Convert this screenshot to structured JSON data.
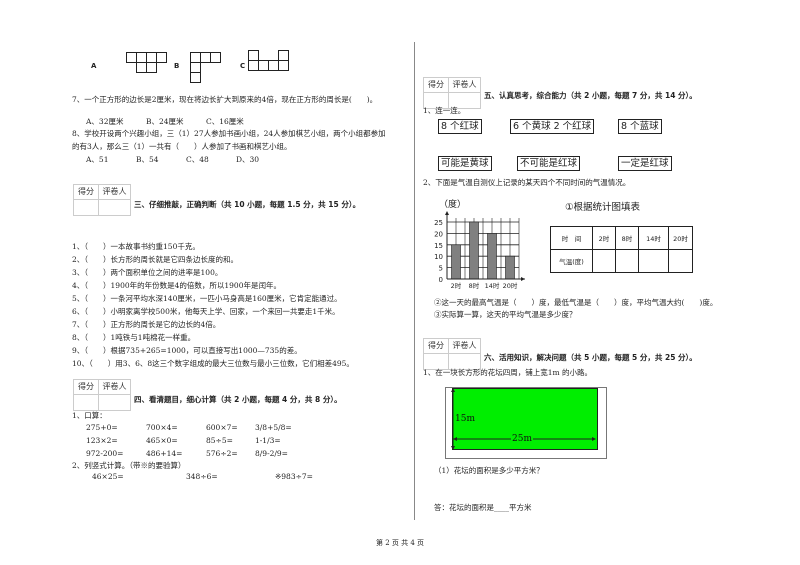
{
  "left": {
    "shapes": {
      "labels": [
        "A",
        "B",
        "C"
      ]
    },
    "q7": {
      "text": "7、一个正方形的边长是2厘米，现在将边长扩大到原来的4倍，现在正方形的周长是(　　)。",
      "options": [
        "A、32厘米",
        "B、24厘米",
        "C、16厘米"
      ]
    },
    "q8": {
      "line1": "8、学校开设两个兴趣小组，三（1）27人参加书画小组，24人参加棋艺小组，两个小组都参加",
      "line2": "的有3人，那么三（1）一共有（　　）人参加了书画和棋艺小组。",
      "options": [
        "A、51",
        "B、54",
        "C、48",
        "D、30"
      ]
    },
    "section3": {
      "score_label": "得分",
      "grader_label": "评卷人",
      "title": "三、仔细推敲，正确判断（共 10 小题，每题 1.5 分，共 15 分）。",
      "items": [
        "1、（　　）一本故事书约重150千克。",
        "2、（　　）长方形的周长就是它四条边长度的和。",
        "3、（　　）两个面积单位之间的进率是100。",
        "4、（　　）1900年的年份数是4的倍数，所以1900年是闰年。",
        "5、（　　）一条河平均水深140厘米，一匹小马身高是160厘米，它肯定能通过。",
        "6、（　　）小明家离学校500米，他每天上学、回家，一个来回一共要走1千米。",
        "7、（　　）正方形的周长是它的边长的4倍。",
        "8、（　　）1吨铁与1吨棉花一样重。",
        "9、（　　）根据735+265=1000，可以直接写出1000—735的差。",
        "10、（　　）用3、6、8这三个数字组成的最大三位数与最小三位数，它们相差495。"
      ]
    },
    "section4": {
      "score_label": "得分",
      "grader_label": "评卷人",
      "title": "四、看清题目，细心计算（共 2 小题，每题 4 分，共 8 分）。",
      "q1_label": "1、口算：",
      "oral": [
        [
          "275+0=",
          "700×4=",
          "600×7=",
          "3/8+5/8="
        ],
        [
          "123×2=",
          "465×0=",
          "85÷5=",
          "1-1/3="
        ],
        [
          "972-200=",
          "486+14=",
          "576÷2=",
          "8/9-2/9="
        ]
      ],
      "q2_label": "2、列竖式计算。（带※的要验算）",
      "vertical": [
        "46×25=",
        "348÷6=",
        "※983÷7="
      ]
    }
  },
  "right": {
    "section5": {
      "score_label": "得分",
      "grader_label": "评卷人",
      "title": "五、认真思考，综合能力（共 2 小题，每题 7 分，共 14 分）。",
      "q1_label": "1、连一连。",
      "top_boxes": [
        "8 个红球",
        "6 个黄球 2 个红球",
        "8 个蓝球"
      ],
      "bottom_boxes": [
        "可能是黄球",
        "不可能是红球",
        "一定是红球"
      ],
      "q2_label": "2、下面是气温自测仪上记录的某天四个不同时间的气温情况。",
      "table_title": "①根据统计图填表",
      "table_headers": [
        "时　间",
        "2时",
        "8时",
        "14时",
        "20时"
      ],
      "table_row_label": "气温(度)",
      "sub2": "②这一天的最高气温是（　　）度，最低气温是（　　）度，平均气温大约(　　)度。",
      "sub3": "③实际算一算，这天的平均气温是多少度？"
    },
    "section6": {
      "score_label": "得分",
      "grader_label": "评卷人",
      "title": "六、活用知识，解决问题（共 5 小题，每题 5 分，共 25 分）。",
      "q1_label": "1、在一块长方形的花坛四周，铺上宽1m 的小路。",
      "height_label": "15m",
      "width_label": "25m",
      "sub1": "（1）花坛的面积是多少平方米？",
      "answer": "答：花坛的面积是____平方米"
    }
  },
  "footer": "第 2 页 共 4 页",
  "chart_data": {
    "type": "bar",
    "title": "",
    "ylabel": "（度）",
    "xlabel": "",
    "categories": [
      "2时",
      "8时",
      "14时",
      "20时"
    ],
    "values": [
      15,
      25,
      20,
      10
    ],
    "ylim": [
      0,
      25
    ],
    "yticks": [
      0,
      5,
      10,
      15,
      20,
      25
    ],
    "grid": true,
    "bar_color": "#808080"
  }
}
